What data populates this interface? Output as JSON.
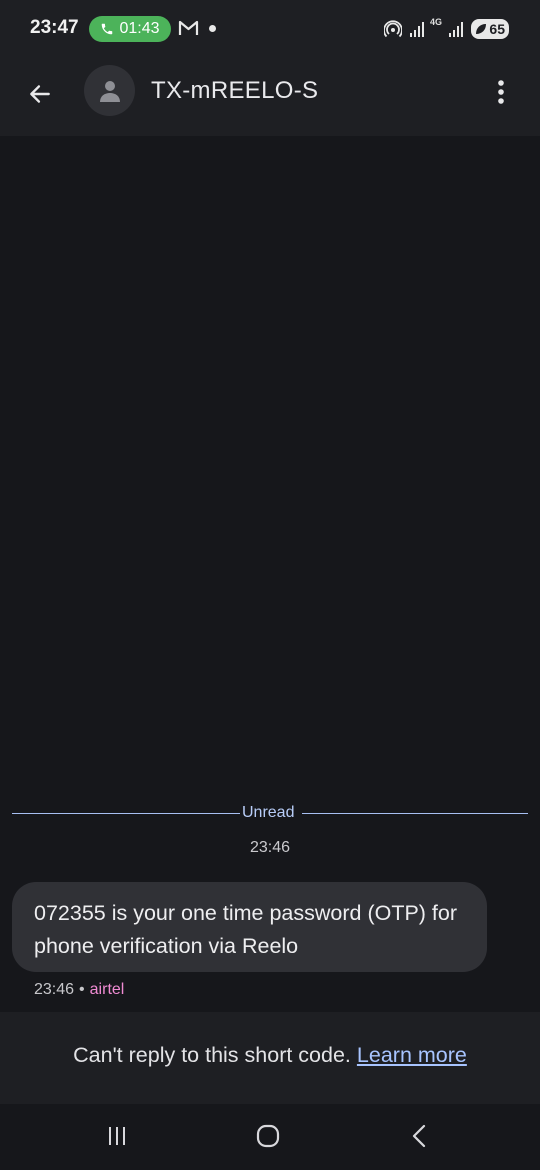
{
  "status_bar": {
    "time": "23:47",
    "call_duration": "01:43",
    "network_type": "4G",
    "battery_level": "65",
    "icons": [
      "phone-icon",
      "gmail-icon",
      "dot-icon",
      "hotspot-icon",
      "signal-icon",
      "battery-icon"
    ]
  },
  "header": {
    "title": "TX-mREELO-S",
    "icons": [
      "back-arrow-icon",
      "person-icon",
      "more-vert-icon"
    ]
  },
  "conversation": {
    "unread_label": "Unread",
    "divider_time": "23:46",
    "messages": [
      {
        "text": "072355 is your one time password (OTP) for phone verification via Reelo",
        "time": "23:46",
        "separator": "•",
        "carrier": "airtel"
      }
    ]
  },
  "footer": {
    "notice": "Can't reply to this short code.",
    "link_label": "Learn more"
  },
  "nav_bar": {
    "icons": [
      "recents-icon",
      "home-icon",
      "back-icon"
    ]
  },
  "colors": {
    "background": "#16171b",
    "surface": "#1e1f23",
    "bubble": "#303136",
    "accent_blue": "#a8c4ff",
    "carrier_pink": "#f08bd3",
    "call_green": "#4cb35a"
  }
}
